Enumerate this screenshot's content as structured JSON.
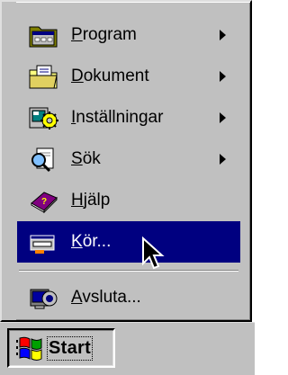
{
  "start_menu": {
    "items": [
      {
        "label_underlined": "P",
        "label_rest": "rogram",
        "icon": "programs-folder-icon",
        "has_submenu": true,
        "selected": false
      },
      {
        "label_underlined": "D",
        "label_rest": "okument",
        "icon": "documents-folder-icon",
        "has_submenu": true,
        "selected": false
      },
      {
        "label_underlined": "I",
        "label_rest": "nställningar",
        "icon": "settings-icon",
        "has_submenu": true,
        "selected": false
      },
      {
        "label_underlined": "S",
        "label_rest": "ök",
        "icon": "find-icon",
        "has_submenu": true,
        "selected": false
      },
      {
        "label_underlined": "H",
        "label_rest": "jälp",
        "icon": "help-book-icon",
        "has_submenu": false,
        "selected": false
      },
      {
        "label_underlined": "K",
        "label_rest": "ör...",
        "icon": "run-icon",
        "has_submenu": false,
        "selected": true
      }
    ],
    "shutdown": {
      "label_underlined": "A",
      "label_rest": "vsluta...",
      "icon": "shutdown-icon"
    }
  },
  "taskbar": {
    "start_label": "Start",
    "start_icon": "windows-logo-icon"
  },
  "colors": {
    "face": "#c0c0c0",
    "highlight": "#000080",
    "highlight_text": "#ffffff"
  }
}
